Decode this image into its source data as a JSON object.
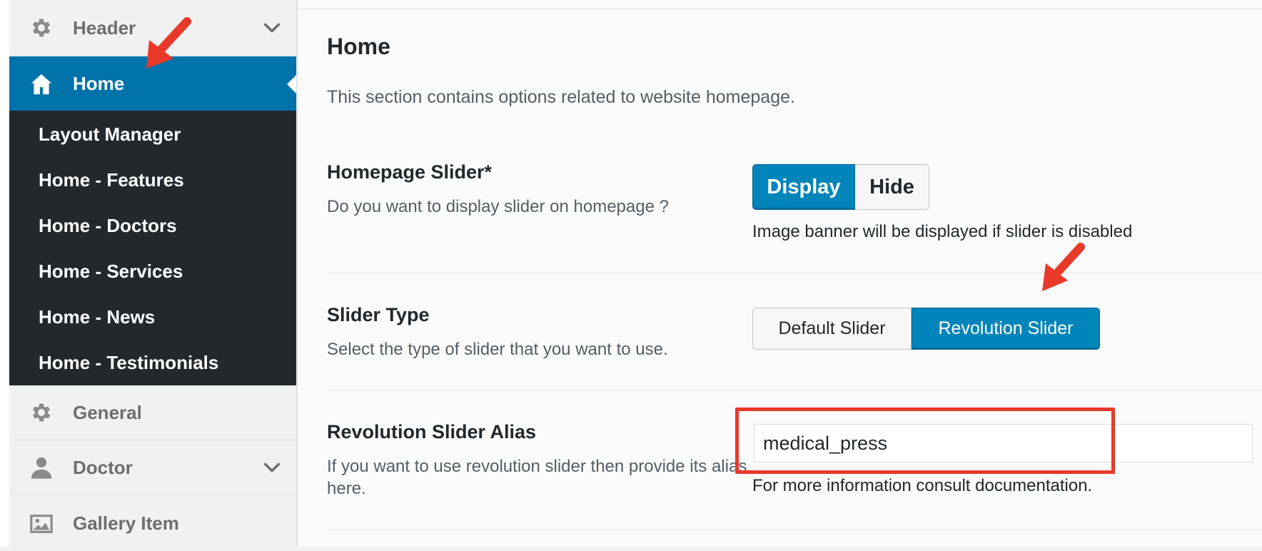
{
  "sidebar": {
    "items": [
      {
        "label": "Header",
        "icon": "gear-icon",
        "has_chevron": true
      },
      {
        "label": "Home",
        "icon": "home-icon",
        "active": true
      },
      {
        "label": "General",
        "icon": "gear-icon"
      },
      {
        "label": "Doctor",
        "icon": "person-icon",
        "has_chevron": true
      },
      {
        "label": "Gallery Item",
        "icon": "image-icon"
      }
    ],
    "submenu": [
      "Layout Manager",
      "Home - Features",
      "Home - Doctors",
      "Home - Services",
      "Home - News",
      "Home - Testimonials"
    ]
  },
  "main": {
    "title": "Home",
    "description": "This section contains options related to website homepage.",
    "options": [
      {
        "title": "Homepage Slider*",
        "description": "Do you want to display slider on homepage ?",
        "buttons": [
          "Display",
          "Hide"
        ],
        "selected": "Display",
        "note": "Image banner will be displayed if slider is disabled"
      },
      {
        "title": "Slider Type",
        "description": "Select the type of slider that you want to use.",
        "buttons": [
          "Default Slider",
          "Revolution Slider"
        ],
        "selected": "Revolution Slider"
      },
      {
        "title": "Revolution Slider Alias",
        "description": "If you want to use revolution slider then provide its alias here.",
        "value": "medical_press",
        "note": "For more information consult documentation."
      }
    ]
  },
  "colors": {
    "accent": "#0073aa",
    "button_active": "#0085ba",
    "submenu_bg": "#23282d",
    "annotation": "#e8392b"
  }
}
